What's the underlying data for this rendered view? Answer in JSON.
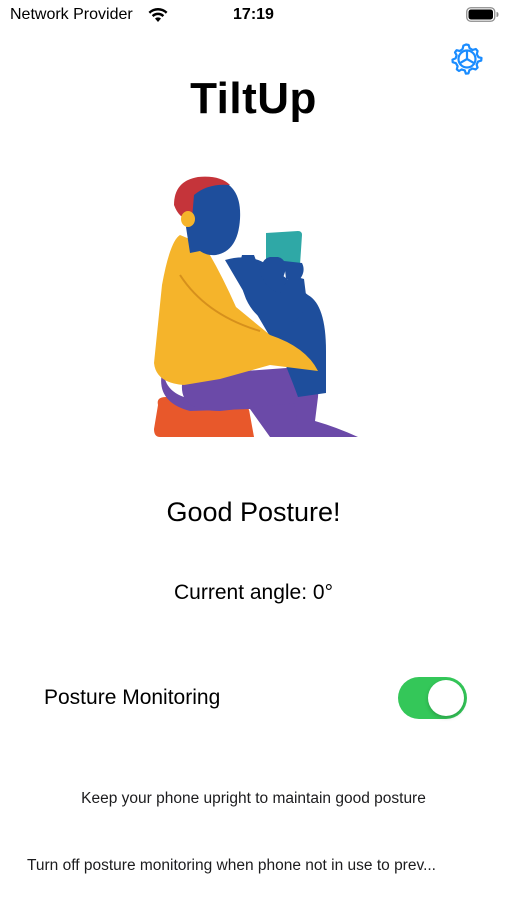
{
  "status_bar": {
    "carrier": "Network Provider",
    "time": "17:19",
    "wifi_icon": "wifi-icon",
    "battery_icon": "battery-icon"
  },
  "header": {
    "title": "TiltUp",
    "settings_icon": "gear-icon"
  },
  "illustration": {
    "icon": "person-reading-phone-illustration",
    "colors": {
      "hair": "#c5343a",
      "skin": "#1e4e9c",
      "phone": "#2fa8a6",
      "shirt": "#f5b42b",
      "pants": "#6b4aa8",
      "seat": "#e8582b"
    }
  },
  "posture": {
    "status": "Good Posture!",
    "angle_text": "Current angle: 0°"
  },
  "monitoring": {
    "label": "Posture Monitoring",
    "enabled": true,
    "toggle_color": "#34c759"
  },
  "hints": {
    "primary": "Keep your phone upright to maintain good posture",
    "secondary": "Turn off posture monitoring when phone not in use to prev..."
  },
  "colors": {
    "accent": "#1a8cff",
    "background": "#ffffff"
  }
}
